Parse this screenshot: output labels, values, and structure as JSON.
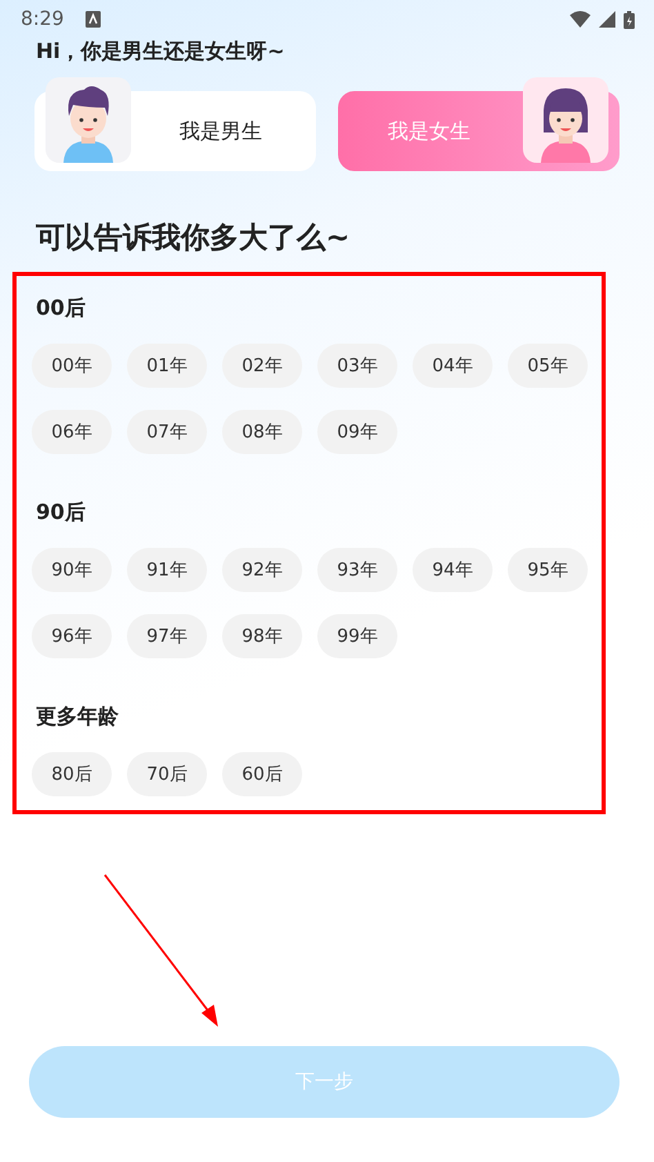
{
  "status_bar": {
    "time": "8:29"
  },
  "greeting": "Hi，你是男生还是女生呀~",
  "genders": [
    {
      "kind": "male",
      "label": "我是男生",
      "selected": false
    },
    {
      "kind": "female",
      "label": "我是女生",
      "selected": true
    }
  ],
  "age_title": "可以告诉我你多大了么~",
  "age_groups": [
    {
      "title": "00后",
      "options": [
        {
          "label": "00年",
          "selected": false
        },
        {
          "label": "01年",
          "selected": false
        },
        {
          "label": "02年",
          "selected": false
        },
        {
          "label": "03年",
          "selected": false
        },
        {
          "label": "04年",
          "selected": false
        },
        {
          "label": "05年",
          "selected": false
        },
        {
          "label": "06年",
          "selected": false
        },
        {
          "label": "07年",
          "selected": false
        },
        {
          "label": "08年",
          "selected": false
        },
        {
          "label": "09年",
          "selected": false
        }
      ]
    },
    {
      "title": "90后",
      "options": [
        {
          "label": "90年",
          "selected": false
        },
        {
          "label": "91年",
          "selected": false
        },
        {
          "label": "92年",
          "selected": false
        },
        {
          "label": "93年",
          "selected": false
        },
        {
          "label": "94年",
          "selected": false
        },
        {
          "label": "95年",
          "selected": false
        },
        {
          "label": "96年",
          "selected": false
        },
        {
          "label": "97年",
          "selected": false
        },
        {
          "label": "98年",
          "selected": false
        },
        {
          "label": "99年",
          "selected": false
        }
      ]
    },
    {
      "title": "更多年龄",
      "options": [
        {
          "label": "80后",
          "selected": false
        },
        {
          "label": "70后",
          "selected": false
        },
        {
          "label": "60后",
          "selected": false
        }
      ]
    }
  ],
  "next_button": {
    "label": "下一步",
    "disabled": true
  }
}
